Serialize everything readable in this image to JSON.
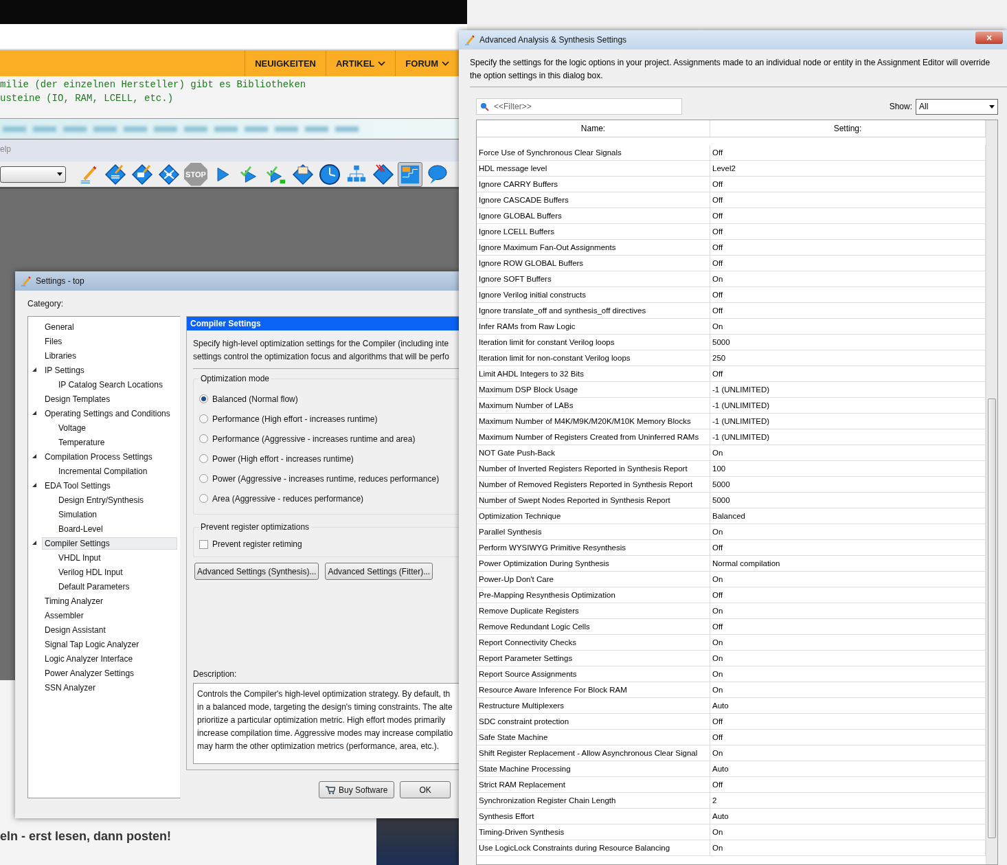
{
  "browser": {
    "nav": [
      {
        "label": "NEUIGKEITEN",
        "dropdown": false
      },
      {
        "label": "ARTIKEL",
        "dropdown": true
      },
      {
        "label": "FORUM",
        "dropdown": true
      }
    ],
    "code_lines": [
      "milie (der einzelnen Hersteller) gibt es Bibliotheken",
      "usteine (IO, RAM, LCELL, etc.)"
    ],
    "menu_fragment": "elp",
    "toolbar": [
      {
        "kind": "pencil",
        "selected": false
      },
      {
        "kind": "diamond-pencil",
        "selected": false
      },
      {
        "kind": "diamond-chip",
        "selected": false
      },
      {
        "kind": "diamond-cross",
        "selected": false
      },
      {
        "kind": "stop",
        "label": "STOP",
        "selected": false
      },
      {
        "kind": "play",
        "selected": false
      },
      {
        "kind": "check-play",
        "selected": false
      },
      {
        "kind": "check-play-plug",
        "selected": false
      },
      {
        "kind": "diamond-folder",
        "selected": false
      },
      {
        "kind": "clock",
        "selected": false
      },
      {
        "kind": "hierarchy",
        "selected": false
      },
      {
        "kind": "diamond-stripes",
        "selected": false
      },
      {
        "kind": "floorplan",
        "selected": true
      },
      {
        "kind": "bubble",
        "selected": false
      }
    ],
    "footer_heading": "eln - erst lesen, dann posten!"
  },
  "settings_dialog": {
    "title": "Settings - top",
    "category_label": "Category:",
    "categories": [
      {
        "label": "General",
        "selected": false
      },
      {
        "label": "Files",
        "selected": false
      },
      {
        "label": "Libraries",
        "selected": false
      },
      {
        "label": "IP Settings",
        "selected": false,
        "expanded": true,
        "children": [
          {
            "label": "IP Catalog Search Locations",
            "selected": false
          }
        ]
      },
      {
        "label": "Design Templates",
        "selected": false
      },
      {
        "label": "Operating Settings and Conditions",
        "selected": false,
        "expanded": true,
        "children": [
          {
            "label": "Voltage",
            "selected": false
          },
          {
            "label": "Temperature",
            "selected": false
          }
        ]
      },
      {
        "label": "Compilation Process Settings",
        "selected": false,
        "expanded": true,
        "children": [
          {
            "label": "Incremental Compilation",
            "selected": false
          }
        ]
      },
      {
        "label": "EDA Tool Settings",
        "selected": false,
        "expanded": true,
        "children": [
          {
            "label": "Design Entry/Synthesis",
            "selected": false
          },
          {
            "label": "Simulation",
            "selected": false
          },
          {
            "label": "Board-Level",
            "selected": false
          }
        ]
      },
      {
        "label": "Compiler Settings",
        "selected": true,
        "expanded": true,
        "children": [
          {
            "label": "VHDL Input",
            "selected": false
          },
          {
            "label": "Verilog HDL Input",
            "selected": false
          },
          {
            "label": "Default Parameters",
            "selected": false
          }
        ]
      },
      {
        "label": "Timing Analyzer",
        "selected": false
      },
      {
        "label": "Assembler",
        "selected": false
      },
      {
        "label": "Design Assistant",
        "selected": false
      },
      {
        "label": "Signal Tap Logic Analyzer",
        "selected": false
      },
      {
        "label": "Logic Analyzer Interface",
        "selected": false
      },
      {
        "label": "Power Analyzer Settings",
        "selected": false
      },
      {
        "label": "SSN Analyzer",
        "selected": false
      }
    ],
    "panel_title": "Compiler Settings",
    "intro_lines": [
      "Specify high-level optimization settings for the Compiler (including inte",
      "settings control the optimization focus and algorithms that will be perfo"
    ],
    "optimization_mode": {
      "label": "Optimization mode",
      "options": [
        {
          "label": "Balanced (Normal flow)",
          "selected": true
        },
        {
          "label": "Performance (High effort - increases runtime)",
          "selected": false
        },
        {
          "label": "Performance (Aggressive - increases runtime and area)",
          "selected": false
        },
        {
          "label": "Power (High effort - increases runtime)",
          "selected": false
        },
        {
          "label": "Power (Aggressive - increases runtime, reduces performance)",
          "selected": false
        },
        {
          "label": "Area (Aggressive - reduces performance)",
          "selected": false
        }
      ]
    },
    "prevent_group": {
      "label": "Prevent register optimizations",
      "checkbox": {
        "label": "Prevent register retiming",
        "checked": false
      }
    },
    "advanced_buttons": [
      "Advanced Settings (Synthesis)...",
      "Advanced Settings (Fitter)..."
    ],
    "description_label": "Description:",
    "description_lines": [
      "Controls the Compiler's high-level optimization strategy.  By default, th",
      "in a balanced mode, targeting the design's timing constraints.  The alte",
      "prioritize a particular optimization metric.  High effort modes primarily",
      "increase compilation time.  Aggressive modes may increase compilatio",
      "may harm the other optimization metrics (performance, area, etc.)."
    ],
    "buttons": [
      "Buy Software",
      "OK"
    ]
  },
  "advanced_dialog": {
    "title": "Advanced Analysis & Synthesis Settings",
    "close": "×",
    "intro": "Specify the settings for the logic options in your project.  Assignments made to an individual node or entity in the Assignment Editor will override the option settings in this dialog box.",
    "filter": {
      "placeholder": "<<Filter>>"
    },
    "show": {
      "label": "Show:",
      "value": "All"
    },
    "table": {
      "columns": [
        "Name:",
        "Setting:"
      ],
      "rows": [
        [
          "Force Use of Synchronous Clear Signals",
          "Off"
        ],
        [
          "HDL message level",
          "Level2"
        ],
        [
          "Ignore CARRY Buffers",
          "Off"
        ],
        [
          "Ignore CASCADE Buffers",
          "Off"
        ],
        [
          "Ignore GLOBAL Buffers",
          "Off"
        ],
        [
          "Ignore LCELL Buffers",
          "Off"
        ],
        [
          "Ignore Maximum Fan-Out Assignments",
          "Off"
        ],
        [
          "Ignore ROW GLOBAL Buffers",
          "Off"
        ],
        [
          "Ignore SOFT Buffers",
          "On"
        ],
        [
          "Ignore Verilog initial constructs",
          "Off"
        ],
        [
          "Ignore translate_off and synthesis_off directives",
          "Off"
        ],
        [
          "Infer RAMs from Raw Logic",
          "On"
        ],
        [
          "Iteration limit for constant Verilog loops",
          "5000"
        ],
        [
          "Iteration limit for non-constant Verilog loops",
          "250"
        ],
        [
          "Limit AHDL Integers to 32 Bits",
          "Off"
        ],
        [
          "Maximum DSP Block Usage",
          "-1 (UNLIMITED)"
        ],
        [
          "Maximum Number of LABs",
          "-1 (UNLIMITED)"
        ],
        [
          "Maximum Number of M4K/M9K/M20K/M10K Memory Blocks",
          "-1 (UNLIMITED)"
        ],
        [
          "Maximum Number of Registers Created from Uninferred RAMs",
          "-1 (UNLIMITED)"
        ],
        [
          "NOT Gate Push-Back",
          "On"
        ],
        [
          "Number of Inverted Registers Reported in Synthesis Report",
          "100"
        ],
        [
          "Number of Removed Registers Reported in Synthesis Report",
          "5000"
        ],
        [
          "Number of Swept Nodes Reported in Synthesis Report",
          "5000"
        ],
        [
          "Optimization Technique",
          "Balanced"
        ],
        [
          "Parallel Synthesis",
          "On"
        ],
        [
          "Perform WYSIWYG Primitive Resynthesis",
          "Off"
        ],
        [
          "Power Optimization During Synthesis",
          "Normal compilation"
        ],
        [
          "Power-Up Don't Care",
          "On"
        ],
        [
          "Pre-Mapping Resynthesis Optimization",
          "Off"
        ],
        [
          "Remove Duplicate Registers",
          "On"
        ],
        [
          "Remove Redundant Logic Cells",
          "Off"
        ],
        [
          "Report Connectivity Checks",
          "On"
        ],
        [
          "Report Parameter Settings",
          "On"
        ],
        [
          "Report Source Assignments",
          "On"
        ],
        [
          "Resource Aware Inference For Block RAM",
          "On"
        ],
        [
          "Restructure Multiplexers",
          "Auto"
        ],
        [
          "SDC constraint protection",
          "Off"
        ],
        [
          "Safe State Machine",
          "Off"
        ],
        [
          "Shift Register Replacement - Allow Asynchronous Clear Signal",
          "On"
        ],
        [
          "State Machine Processing",
          "Auto"
        ],
        [
          "Strict RAM Replacement",
          "Off"
        ],
        [
          "Synchronization Register Chain Length",
          "2"
        ],
        [
          "Synthesis Effort",
          "Auto"
        ],
        [
          "Timing-Driven Synthesis",
          "On"
        ],
        [
          "Use LogicLock Constraints during Resource Balancing",
          "On"
        ]
      ]
    }
  }
}
